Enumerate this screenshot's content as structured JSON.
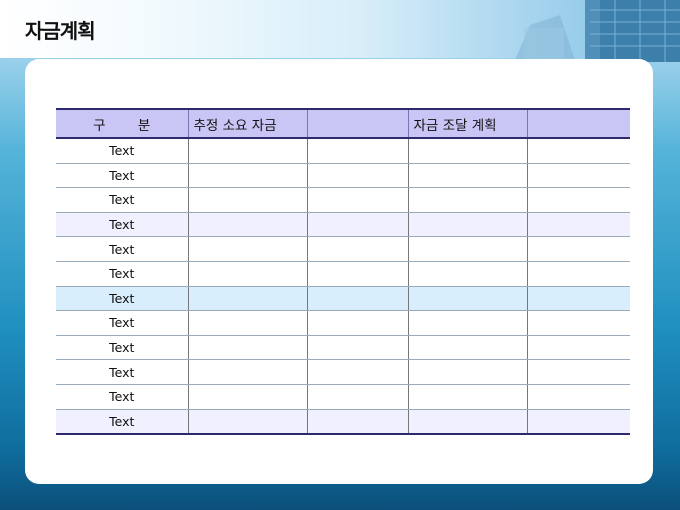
{
  "slide": {
    "title": "자금계획"
  },
  "table": {
    "headers": [
      "구 분",
      "추정 소요 자금",
      "",
      "자금 조달 계획",
      ""
    ],
    "rows": [
      {
        "label": "Text",
        "shade": "none"
      },
      {
        "label": "Text",
        "shade": "none"
      },
      {
        "label": "Text",
        "shade": "none"
      },
      {
        "label": "Text",
        "shade": "lavender"
      },
      {
        "label": "Text",
        "shade": "none"
      },
      {
        "label": "Text",
        "shade": "none"
      },
      {
        "label": "Text",
        "shade": "blue"
      },
      {
        "label": "Text",
        "shade": "none"
      },
      {
        "label": "Text",
        "shade": "none"
      },
      {
        "label": "Text",
        "shade": "none"
      },
      {
        "label": "Text",
        "shade": "none"
      },
      {
        "label": "Text",
        "shade": "lavender"
      }
    ]
  },
  "colors": {
    "header_fill": "#c9c6f5",
    "rule": "#2d2a6e",
    "row_lavender": "#f0f0ff",
    "row_blue": "#d9eefc"
  }
}
